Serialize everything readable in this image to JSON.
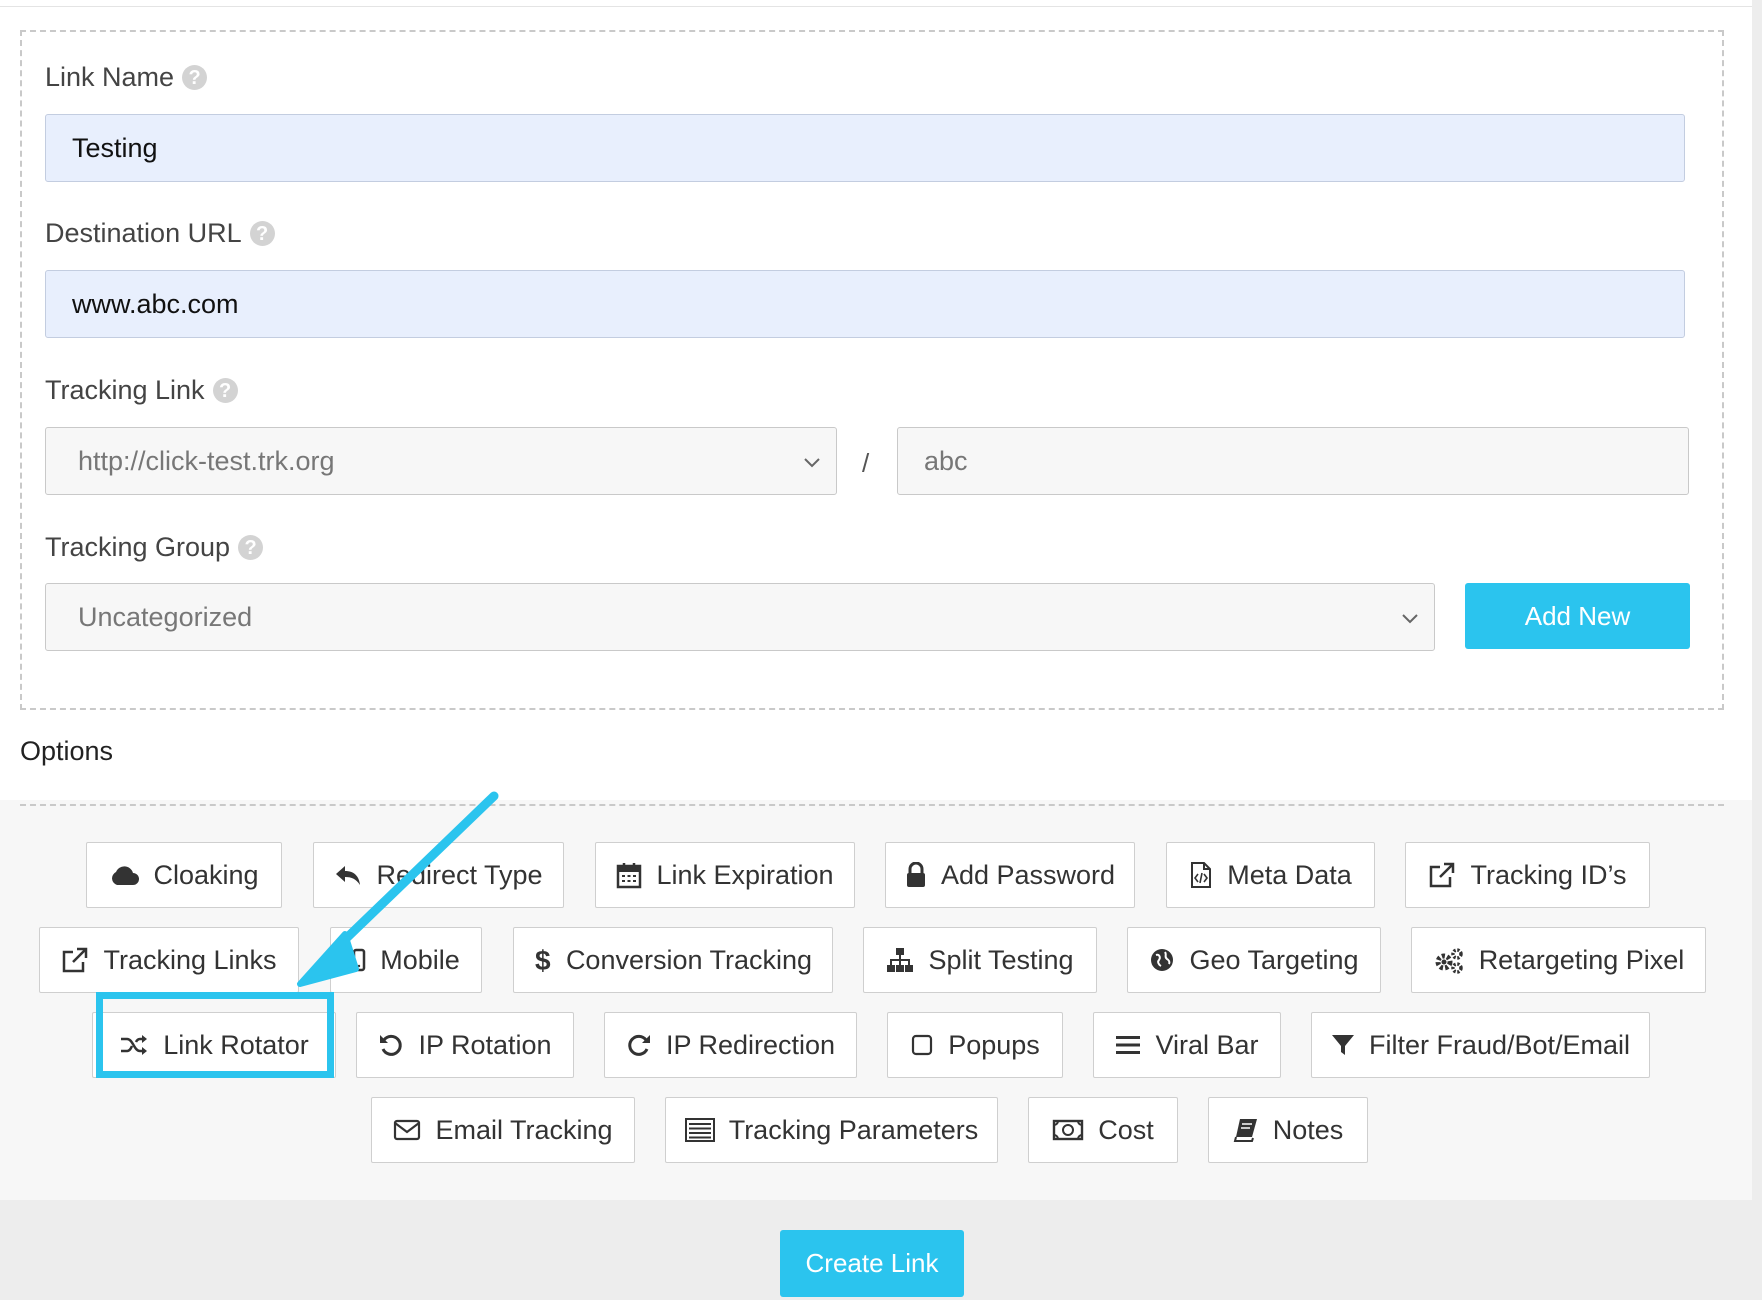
{
  "form": {
    "link_name": {
      "label": "Link Name",
      "value": "Testing"
    },
    "destination_url": {
      "label": "Destination URL",
      "value": "www.abc.com"
    },
    "tracking_link": {
      "label": "Tracking Link",
      "domain": "http://click-test.trk.org",
      "separator": "/",
      "slug": "abc"
    },
    "tracking_group": {
      "label": "Tracking Group",
      "value": "Uncategorized",
      "add_new": "Add New"
    }
  },
  "options": {
    "title": "Options",
    "buttons": [
      {
        "label": "Cloaking",
        "icon": "cloud-icon"
      },
      {
        "label": "Redirect Type",
        "icon": "reply-icon"
      },
      {
        "label": "Link Expiration",
        "icon": "calendar-icon"
      },
      {
        "label": "Add Password",
        "icon": "lock-icon"
      },
      {
        "label": "Meta Data",
        "icon": "code-file-icon"
      },
      {
        "label": "Tracking ID’s",
        "icon": "external-link-icon"
      },
      {
        "label": "Tracking Links",
        "icon": "external-link-icon"
      },
      {
        "label": "Mobile",
        "icon": "mobile-icon"
      },
      {
        "label": "Conversion Tracking",
        "icon": "dollar-icon"
      },
      {
        "label": "Split Testing",
        "icon": "sitemap-icon"
      },
      {
        "label": "Geo Targeting",
        "icon": "globe-icon"
      },
      {
        "label": "Retargeting Pixel",
        "icon": "cogs-icon"
      },
      {
        "label": "Link Rotator",
        "icon": "shuffle-icon"
      },
      {
        "label": "IP Rotation",
        "icon": "undo-icon"
      },
      {
        "label": "IP Redirection",
        "icon": "redo-icon"
      },
      {
        "label": "Popups",
        "icon": "square-icon"
      },
      {
        "label": "Viral Bar",
        "icon": "bars-icon"
      },
      {
        "label": "Filter Fraud/Bot/Email",
        "icon": "filter-icon"
      },
      {
        "label": "Email Tracking",
        "icon": "envelope-icon"
      },
      {
        "label": "Tracking Parameters",
        "icon": "list-icon"
      },
      {
        "label": "Cost",
        "icon": "money-icon"
      },
      {
        "label": "Notes",
        "icon": "book-icon"
      }
    ]
  },
  "actions": {
    "create_link": "Create Link"
  },
  "colors": {
    "accent": "#2bc4ee",
    "input_fill": "#e8effd",
    "options_bg": "#f7f7f7"
  }
}
